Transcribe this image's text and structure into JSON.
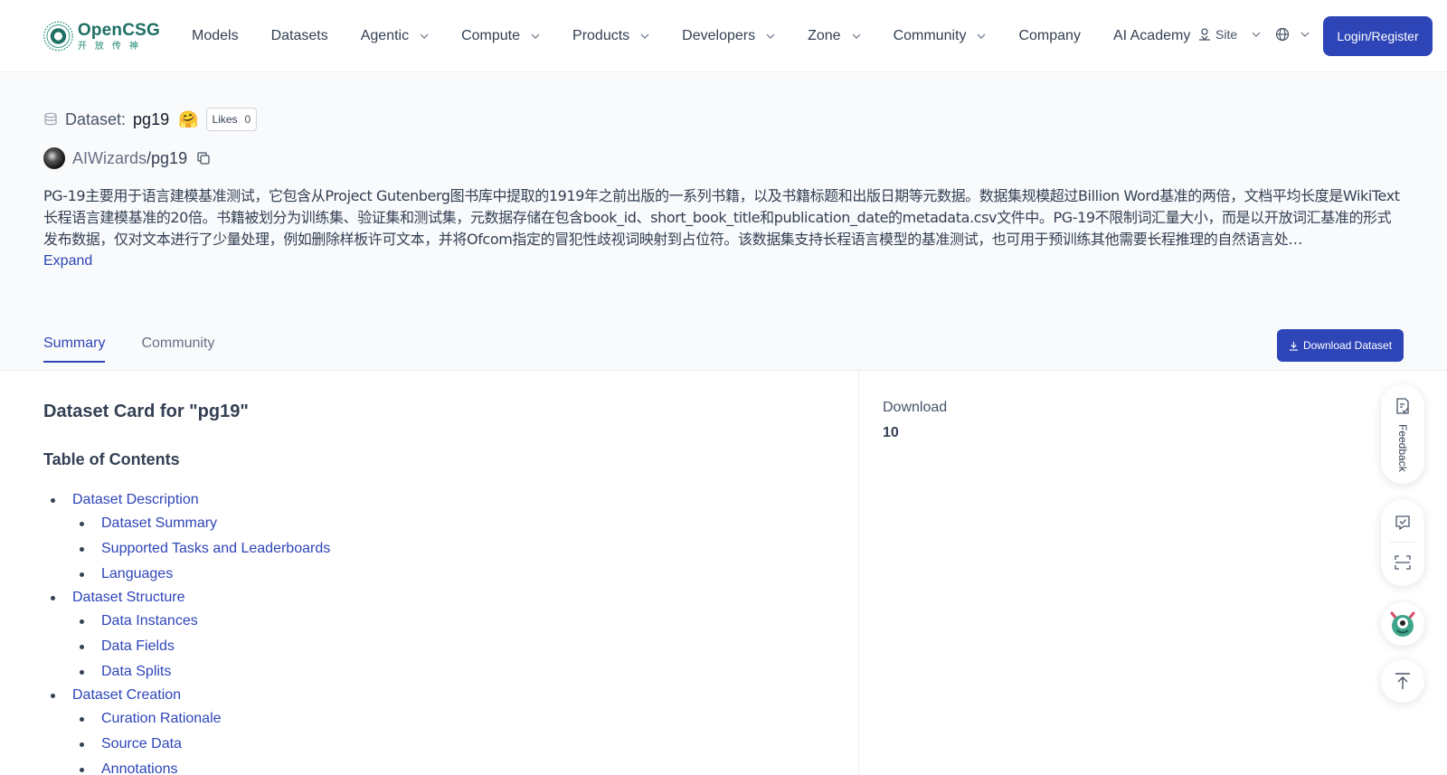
{
  "brand": {
    "name": "OpenCSG",
    "subtitle": "开放传神",
    "color": "#1e6f64"
  },
  "nav": {
    "items": [
      {
        "label": "Models",
        "dropdown": false
      },
      {
        "label": "Datasets",
        "dropdown": false
      },
      {
        "label": "Agentic",
        "dropdown": true
      },
      {
        "label": "Compute",
        "dropdown": true
      },
      {
        "label": "Products",
        "dropdown": true
      },
      {
        "label": "Developers",
        "dropdown": true
      },
      {
        "label": "Zone",
        "dropdown": true
      },
      {
        "label": "Community",
        "dropdown": true
      },
      {
        "label": "Company",
        "dropdown": false
      },
      {
        "label": "AI Academy",
        "dropdown": false
      }
    ],
    "site_label": "Site",
    "login_label": "Login/Register"
  },
  "dataset": {
    "type_label": "Dataset:",
    "name": "pg19",
    "emoji": "🤗",
    "likes_label": "Likes",
    "likes_count": "0",
    "owner": "AIWizards",
    "separator": "/",
    "repo": "pg19",
    "description": "PG-19主要用于语言建模基准测试，它包含从Project Gutenberg图书库中提取的1919年之前出版的一系列书籍，以及书籍标题和出版日期等元数据。数据集规模超过Billion Word基准的两倍，文档平均长度是WikiText长程语言建模基准的20倍。书籍被划分为训练集、验证集和测试集，元数据存储在包含book_id、short_book_title和publication_date的metadata.csv文件中。PG-19不限制词汇量大小，而是以开放词汇基准的形式发布数据，仅对文本进行了少量处理，例如删除样板许可文本，并将Ofcom指定的冒犯性歧视词映射到占位符。该数据集支持长程语言模型的基准测试，也可用于预训练其他需要长程推理的自然语言处…",
    "expand_label": "Expand"
  },
  "tabs": [
    {
      "label": "Summary",
      "active": true
    },
    {
      "label": "Community",
      "active": false
    }
  ],
  "download_button": "Download Dataset",
  "card": {
    "title": "Dataset Card for \"pg19\"",
    "toc_title": "Table of Contents",
    "toc": [
      {
        "label": "Dataset Description",
        "level": 1
      },
      {
        "label": "Dataset Summary",
        "level": 2
      },
      {
        "label": "Supported Tasks and Leaderboards",
        "level": 2
      },
      {
        "label": "Languages",
        "level": 2
      },
      {
        "label": "Dataset Structure",
        "level": 1
      },
      {
        "label": "Data Instances",
        "level": 2
      },
      {
        "label": "Data Fields",
        "level": 2
      },
      {
        "label": "Data Splits",
        "level": 2
      },
      {
        "label": "Dataset Creation",
        "level": 1
      },
      {
        "label": "Curation Rationale",
        "level": 2
      },
      {
        "label": "Source Data",
        "level": 2
      },
      {
        "label": "Annotations",
        "level": 2
      }
    ]
  },
  "sidebar": {
    "download_label": "Download",
    "download_value": "10"
  },
  "float": {
    "feedback_label": "Feedback"
  },
  "colors": {
    "primary": "#2e45b8",
    "text": "#344054"
  }
}
